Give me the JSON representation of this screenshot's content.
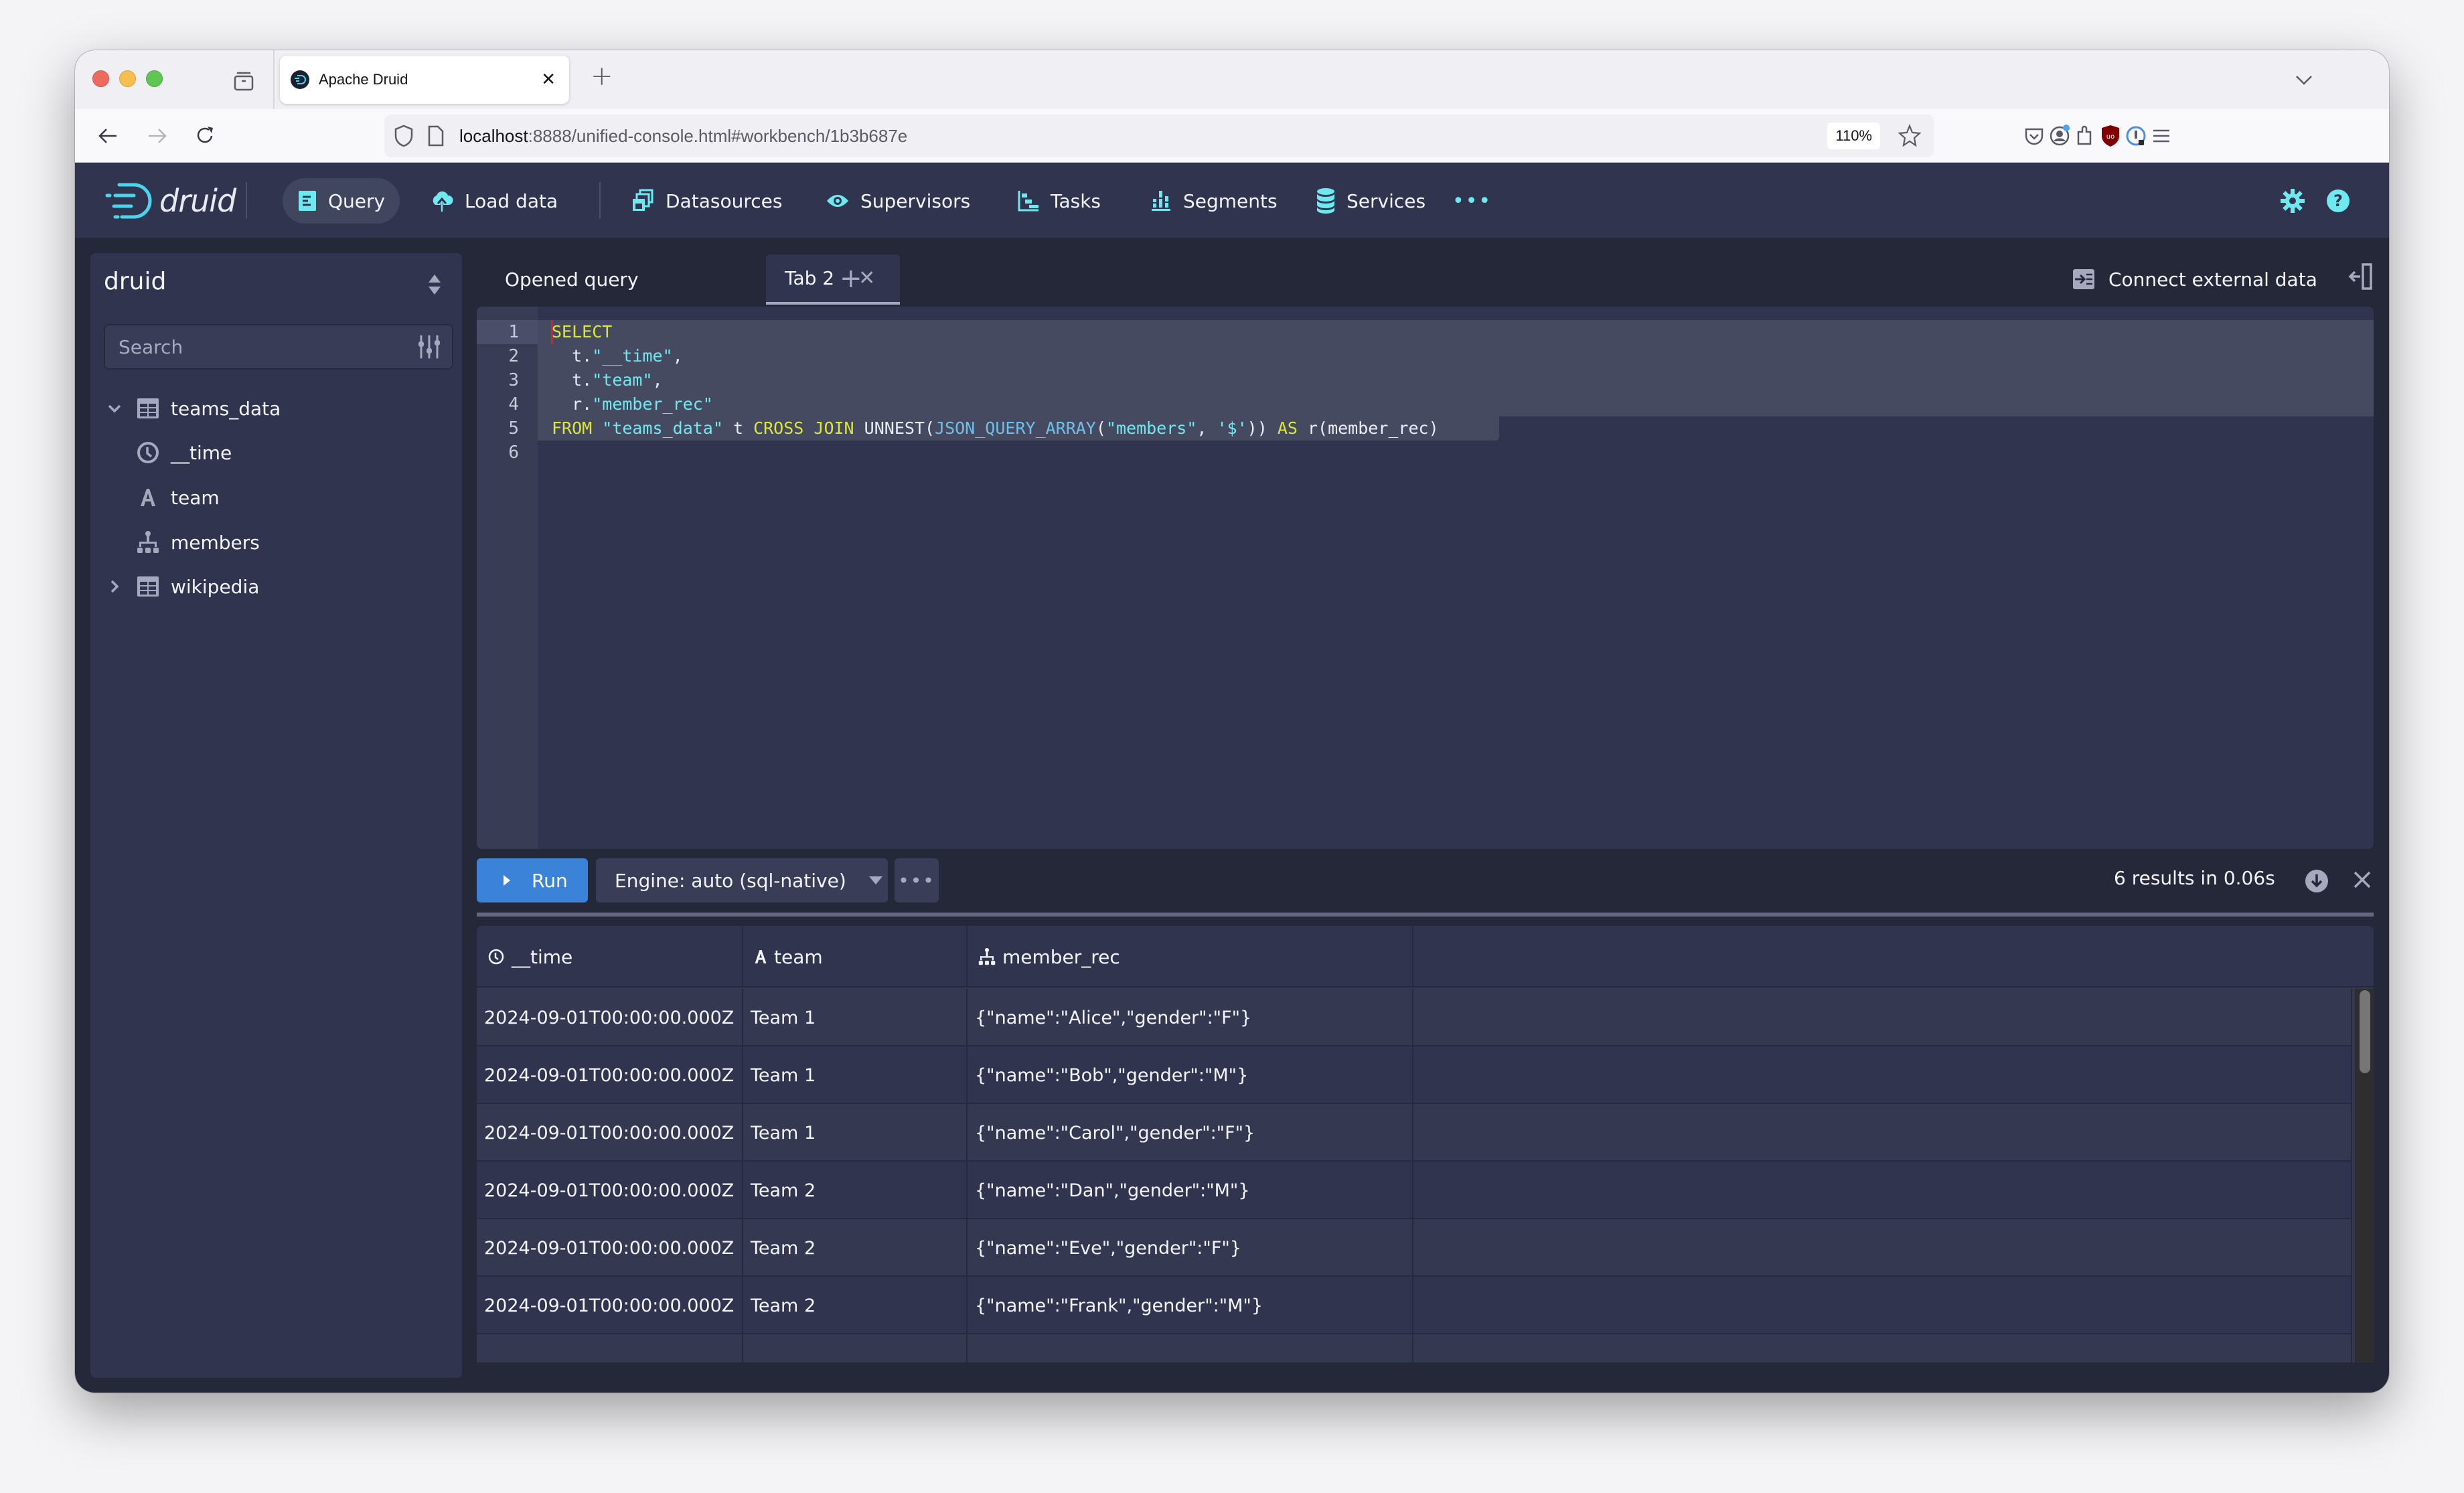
{
  "browser": {
    "tab_title": "Apache Druid",
    "url_host": "localhost",
    "url_rest": ":8888/unified-console.html#workbench/1b3b687e",
    "zoom_level": "110%"
  },
  "nav": {
    "brand": "druid",
    "items": [
      {
        "label": "Query",
        "icon": "query-icon",
        "active": true
      },
      {
        "label": "Load data",
        "icon": "cloud-upload-icon"
      },
      {
        "label": "Datasources",
        "icon": "datasources-icon"
      },
      {
        "label": "Supervisors",
        "icon": "eye-icon"
      },
      {
        "label": "Tasks",
        "icon": "gantt-icon"
      },
      {
        "label": "Segments",
        "icon": "stacked-chart-icon"
      },
      {
        "label": "Services",
        "icon": "database-icon"
      }
    ],
    "more_label": "•••"
  },
  "sidebar": {
    "database": "druid",
    "search_placeholder": "Search",
    "tree": [
      {
        "label": "teams_data",
        "type": "table",
        "expanded": true,
        "columns": [
          {
            "label": "__time",
            "type": "time"
          },
          {
            "label": "team",
            "type": "string"
          },
          {
            "label": "members",
            "type": "json"
          }
        ]
      },
      {
        "label": "wikipedia",
        "type": "table",
        "expanded": false
      }
    ]
  },
  "query_tabs": {
    "tabs": [
      {
        "label": "Opened query",
        "active": false
      },
      {
        "label": "Tab 2",
        "active": true
      }
    ],
    "connect_external": "Connect external data"
  },
  "editor": {
    "line_numbers": [
      "1",
      "2",
      "3",
      "4",
      "5",
      "6"
    ],
    "lines": [
      "SELECT",
      "  t.\"__time\",",
      "  t.\"team\",",
      "  r.\"member_rec\"",
      "FROM \"teams_data\" t CROSS JOIN UNNEST(JSON_QUERY_ARRAY(\"members\", '$')) AS r(member_rec)",
      ""
    ]
  },
  "run_bar": {
    "run_label": "Run",
    "engine_label": "Engine: auto (sql-native)",
    "more_label": "•••",
    "status": "6 results in 0.06s"
  },
  "results": {
    "columns": [
      {
        "label": "__time",
        "type": "time"
      },
      {
        "label": "team",
        "type": "string"
      },
      {
        "label": "member_rec",
        "type": "json"
      }
    ],
    "rows": [
      [
        "2024-09-01T00:00:00.000Z",
        "Team 1",
        "{\"name\":\"Alice\",\"gender\":\"F\"}"
      ],
      [
        "2024-09-01T00:00:00.000Z",
        "Team 1",
        "{\"name\":\"Bob\",\"gender\":\"M\"}"
      ],
      [
        "2024-09-01T00:00:00.000Z",
        "Team 1",
        "{\"name\":\"Carol\",\"gender\":\"F\"}"
      ],
      [
        "2024-09-01T00:00:00.000Z",
        "Team 2",
        "{\"name\":\"Dan\",\"gender\":\"M\"}"
      ],
      [
        "2024-09-01T00:00:00.000Z",
        "Team 2",
        "{\"name\":\"Eve\",\"gender\":\"F\"}"
      ],
      [
        "2024-09-01T00:00:00.000Z",
        "Team 2",
        "{\"name\":\"Frank\",\"gender\":\"M\"}"
      ]
    ]
  },
  "colors": {
    "accent": "#6ee9ef",
    "run_button": "#3a83d8",
    "nav_bg": "#30344e",
    "app_bg": "#252839",
    "keyword": "#dbe53c",
    "string": "#6ee9ef",
    "function": "#6ec0ea"
  }
}
